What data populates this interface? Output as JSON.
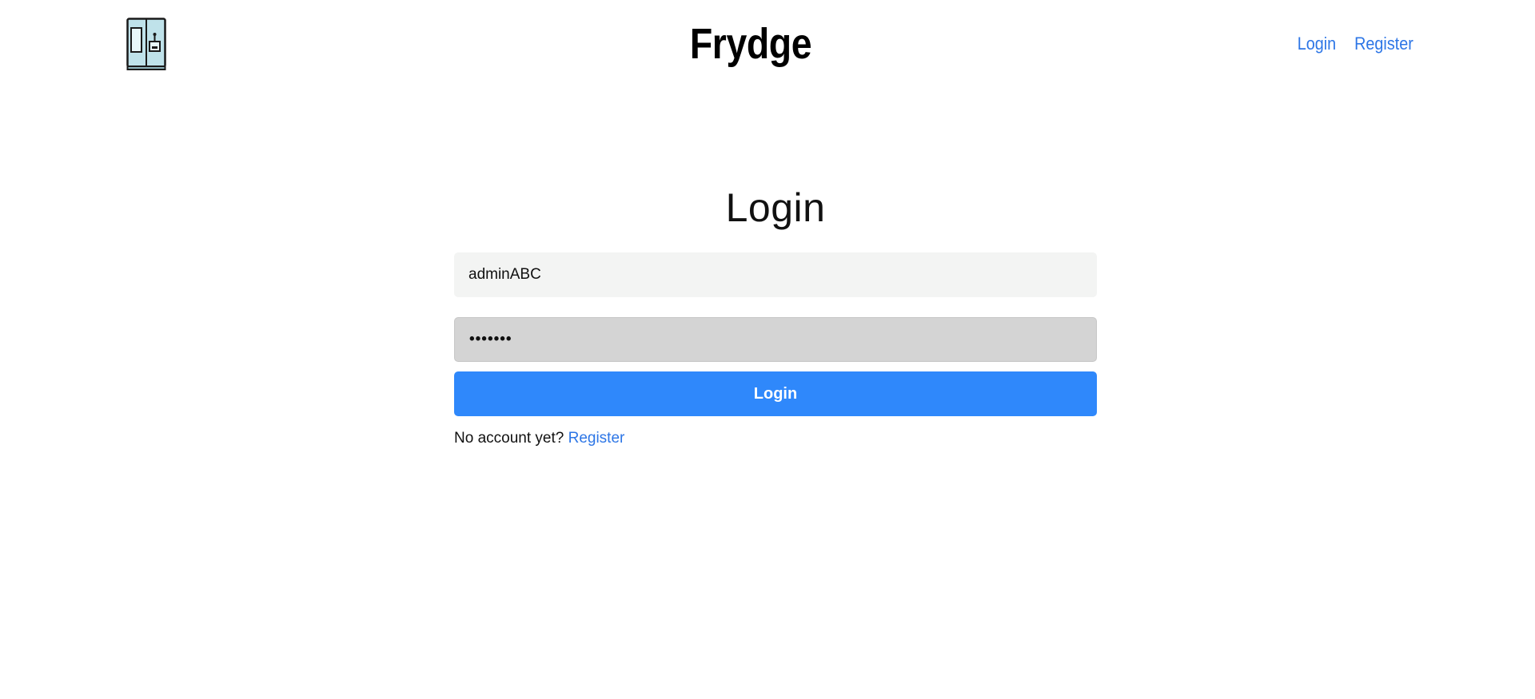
{
  "header": {
    "brand": "Frydge",
    "logo_icon": "fridge-icon",
    "nav": {
      "login_label": "Login",
      "register_label": "Register"
    }
  },
  "login": {
    "title": "Login",
    "username_value": "adminABC",
    "password_value": "•••••••",
    "submit_label": "Login",
    "no_account_text": "No account yet?",
    "register_link_label": "Register"
  },
  "colors": {
    "link": "#2d76e6",
    "button": "#2f88fb",
    "username_bg": "#f3f4f3",
    "password_bg": "#d4d4d4"
  }
}
